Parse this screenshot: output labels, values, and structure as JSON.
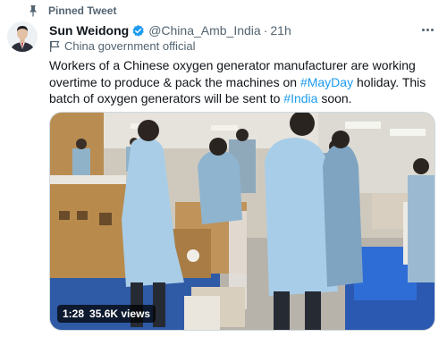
{
  "pinned": {
    "label": "Pinned Tweet",
    "icon": "pin-icon"
  },
  "author": {
    "name": "Sun Weidong",
    "handle": "@China_Amb_India",
    "separator": "·",
    "time": "21h",
    "verified_icon": "verified-badge-icon",
    "affiliation": "China government official",
    "affiliation_icon": "flag-icon"
  },
  "tweet": {
    "text_1": "Workers of a Chinese oxygen generator manufacturer are working overtime to produce & pack the machines on ",
    "hashtag_1": "#MayDay",
    "text_2": " holiday. This batch of oxygen generators will be sent to ",
    "hashtag_2": "#India",
    "text_3": " soon."
  },
  "video": {
    "duration": "1:28",
    "views": "35.6K views"
  },
  "colors": {
    "link": "#1d9bf0",
    "muted": "#536471",
    "verified": "#1d9bf0"
  }
}
